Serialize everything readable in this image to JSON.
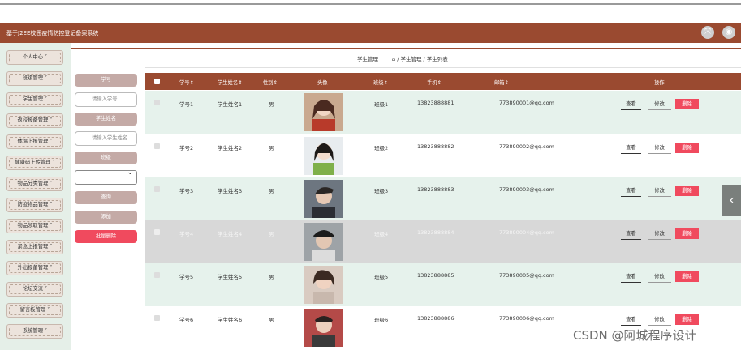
{
  "app": {
    "title": "基于J2EE校园疫情防控登记备案系统"
  },
  "sidebar": {
    "items": [
      {
        "label": "个人中心"
      },
      {
        "label": "班级管理"
      },
      {
        "label": "学生管理"
      },
      {
        "label": "返校报备管理"
      },
      {
        "label": "体温上报管理"
      },
      {
        "label": "健康码上传管理"
      },
      {
        "label": "物品分类管理"
      },
      {
        "label": "防疫物品管理"
      },
      {
        "label": "物品领取管理"
      },
      {
        "label": "紧急上报管理"
      },
      {
        "label": "外出报备管理"
      },
      {
        "label": "论坛交流"
      },
      {
        "label": "留言板管理"
      },
      {
        "label": "系统管理"
      }
    ]
  },
  "breadcrumb": {
    "title": "学生管理",
    "path": "⌂ / 学生管理 / 学生列表"
  },
  "search": {
    "student_no_label": "学号",
    "student_no_placeholder": "请输入学号",
    "student_name_label": "学生姓名",
    "student_name_placeholder": "请输入学生姓名",
    "class_label": "班级",
    "query_button": "查询",
    "add_button": "添加",
    "batch_delete_button": "批量删除"
  },
  "table": {
    "headers": {
      "no": "学号⇕",
      "name": "学生姓名⇕",
      "gender": "性别⇕",
      "avatar": "头像",
      "class": "班级⇕",
      "phone": "手机⇕",
      "email": "邮箱⇕",
      "actions": "操作"
    },
    "actions": {
      "view": "查看",
      "edit": "修改",
      "delete": "删除"
    },
    "rows": [
      {
        "no": "学号1",
        "name": "学生姓名1",
        "gender": "男",
        "class": "班级1",
        "phone": "13823888881",
        "email": "773890001@qq.com"
      },
      {
        "no": "学号2",
        "name": "学生姓名2",
        "gender": "男",
        "class": "班级2",
        "phone": "13823888882",
        "email": "773890002@qq.com"
      },
      {
        "no": "学号3",
        "name": "学生姓名3",
        "gender": "男",
        "class": "班级3",
        "phone": "13823888883",
        "email": "773890003@qq.com"
      },
      {
        "no": "学号4",
        "name": "学生姓名4",
        "gender": "男",
        "class": "班级4",
        "phone": "13823888884",
        "email": "773890004@qq.com"
      },
      {
        "no": "学号5",
        "name": "学生姓名5",
        "gender": "男",
        "class": "班级5",
        "phone": "13823888885",
        "email": "773890005@qq.com"
      },
      {
        "no": "学号6",
        "name": "学生姓名6",
        "gender": "男",
        "class": "班级6",
        "phone": "13823888886",
        "email": "773890006@qq.com"
      }
    ]
  },
  "colors": {
    "header": "#9a4a30",
    "sidebar_bg": "#e5efe8",
    "row_alt": "#e6f2ec",
    "row_hover": "#d8d8d8",
    "delete_button": "#f04a5e",
    "search_label": "#c4aaa6"
  },
  "watermark": "CSDN @阿城程序设计"
}
